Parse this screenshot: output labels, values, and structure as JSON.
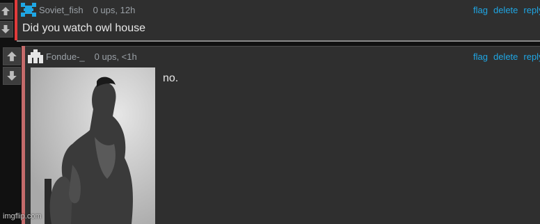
{
  "colors": {
    "background": "#111111",
    "card": "#2f2f2f",
    "accent_top": "#e23b3b",
    "accent_reply": "#c56b6b",
    "link": "#1fa6e4",
    "avatar_top": "#1fa6e4"
  },
  "comments": [
    {
      "username": "Soviet_fish",
      "stats": "0 ups, 12h",
      "text": "Did you watch owl house",
      "avatar_icon": "pixel-avatar-blue-icon",
      "actions": {
        "flag": "flag",
        "delete": "delete",
        "reply": "reply"
      }
    },
    {
      "username": "Fondue-_",
      "stats": "0 ups, <1h",
      "text": "no.",
      "avatar_icon": "pixel-avatar-white-icon",
      "image": "giga-chad-photo",
      "actions": {
        "flag": "flag",
        "delete": "delete",
        "reply": "reply"
      }
    }
  ],
  "watermark": "imgflip.com"
}
